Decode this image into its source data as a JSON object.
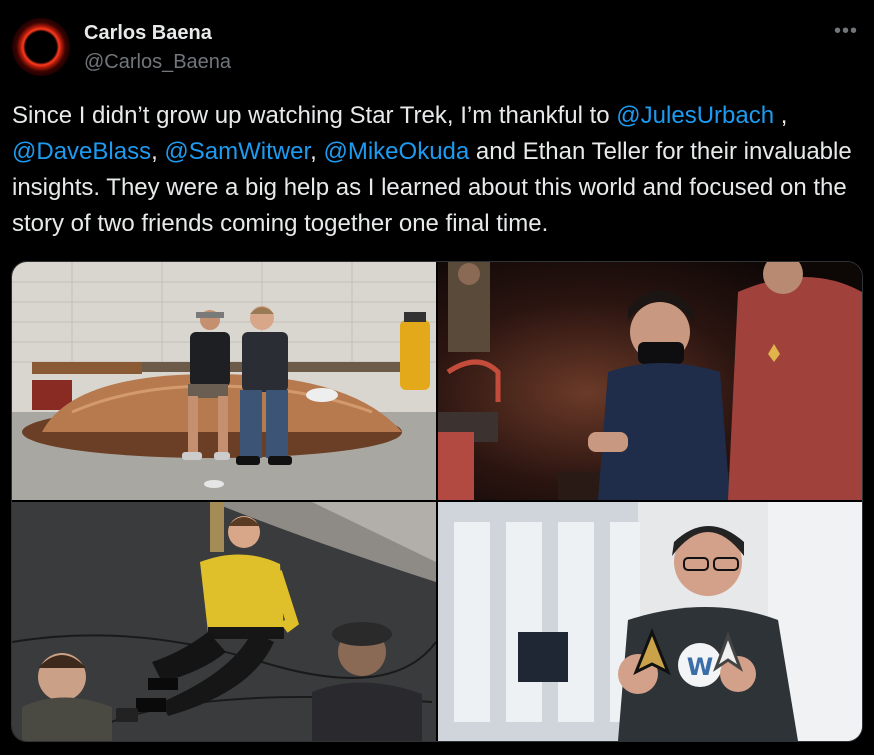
{
  "author": {
    "name": "Carlos Baena",
    "handle": "@Carlos_Baena"
  },
  "more_icon": "more-horizontal-icon",
  "tweet": {
    "seg1": "Since I didn’t grow up watching Star Trek, I’m thankful to ",
    "m1": "@JulesUrbach",
    "seg2": " , ",
    "m2": "@DaveBlass",
    "seg3": ", ",
    "m3": "@SamWitwer",
    "seg4": ",  ",
    "m4": "@MikeOkuda",
    "seg5": " and Ethan Teller for their invaluable insights. They were a big help as I learned about this world and focused on the story of two friends coming together one final time."
  },
  "colors": {
    "background": "#000000",
    "text": "#e7e9ea",
    "muted": "#71767b",
    "link": "#1d9bf0",
    "border": "#2f3336"
  }
}
